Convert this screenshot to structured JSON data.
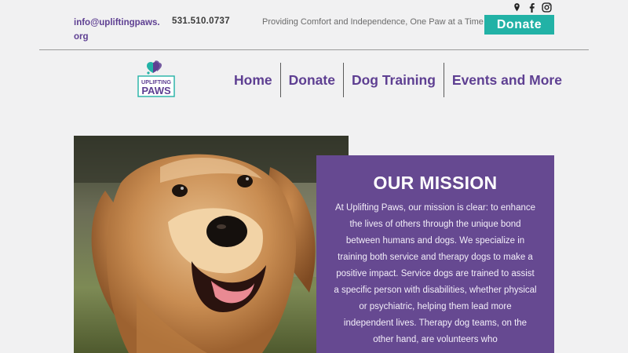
{
  "topbar": {
    "email": "info@upliftingpaws.org",
    "phone": "531.510.0737",
    "tagline": "Providing Comfort and Independence, One Paw at a Time",
    "donate_label": "Donate",
    "social_icons": [
      "location-icon",
      "facebook-icon",
      "instagram-icon"
    ]
  },
  "logo": {
    "line1": "UPLIFTING",
    "line2": "PAWS"
  },
  "nav": {
    "items": [
      {
        "label": "Home"
      },
      {
        "label": "Donate"
      },
      {
        "label": "Dog Training"
      },
      {
        "label": "Events and More"
      }
    ]
  },
  "mission": {
    "title": "OUR MISSION",
    "body": "At Uplifting Paws, our mission is clear: to enhance the lives of others through the unique bond between humans and dogs. We specialize in training both service and therapy dogs to make a positive impact. Service dogs are trained to assist a specific person with disabilities, whether physical or psychiatric, helping them lead more independent lives. Therapy dog teams, on the other hand, are volunteers who"
  },
  "colors": {
    "brand_purple": "#5e3f92",
    "teal": "#22b2a6",
    "mission_bg": "#664991",
    "page_bg": "#f1f1f2"
  }
}
